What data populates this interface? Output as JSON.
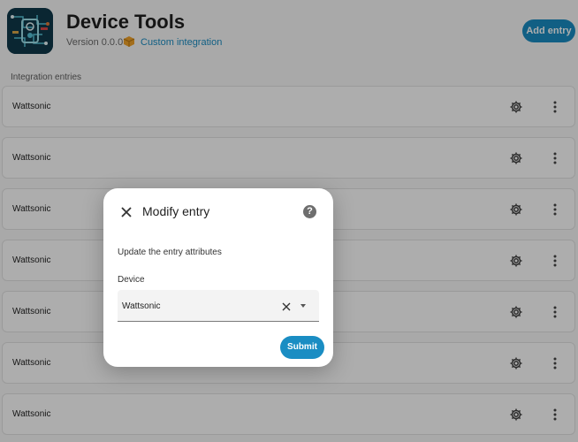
{
  "header": {
    "title": "Device Tools",
    "version": "Version 0.0.0",
    "integration_type": "Custom integration",
    "add_entry_label": "Add entry",
    "logo_icon": "circuit-board-logo",
    "package_icon": "package-icon"
  },
  "section": {
    "label": "Integration entries"
  },
  "entries": [
    {
      "name": "Wattsonic"
    },
    {
      "name": "Wattsonic"
    },
    {
      "name": "Wattsonic"
    },
    {
      "name": "Wattsonic"
    },
    {
      "name": "Wattsonic"
    },
    {
      "name": "Wattsonic"
    },
    {
      "name": "Wattsonic"
    }
  ],
  "dialog": {
    "title": "Modify entry",
    "help_glyph": "?",
    "description": "Update the entry attributes",
    "field_label": "Device",
    "field_value": "Wattsonic",
    "submit_label": "Submit"
  },
  "colors": {
    "accent": "#1a8dc3",
    "page_background": "#fafafa",
    "scrim": "rgba(0,0,0,0.32)"
  }
}
